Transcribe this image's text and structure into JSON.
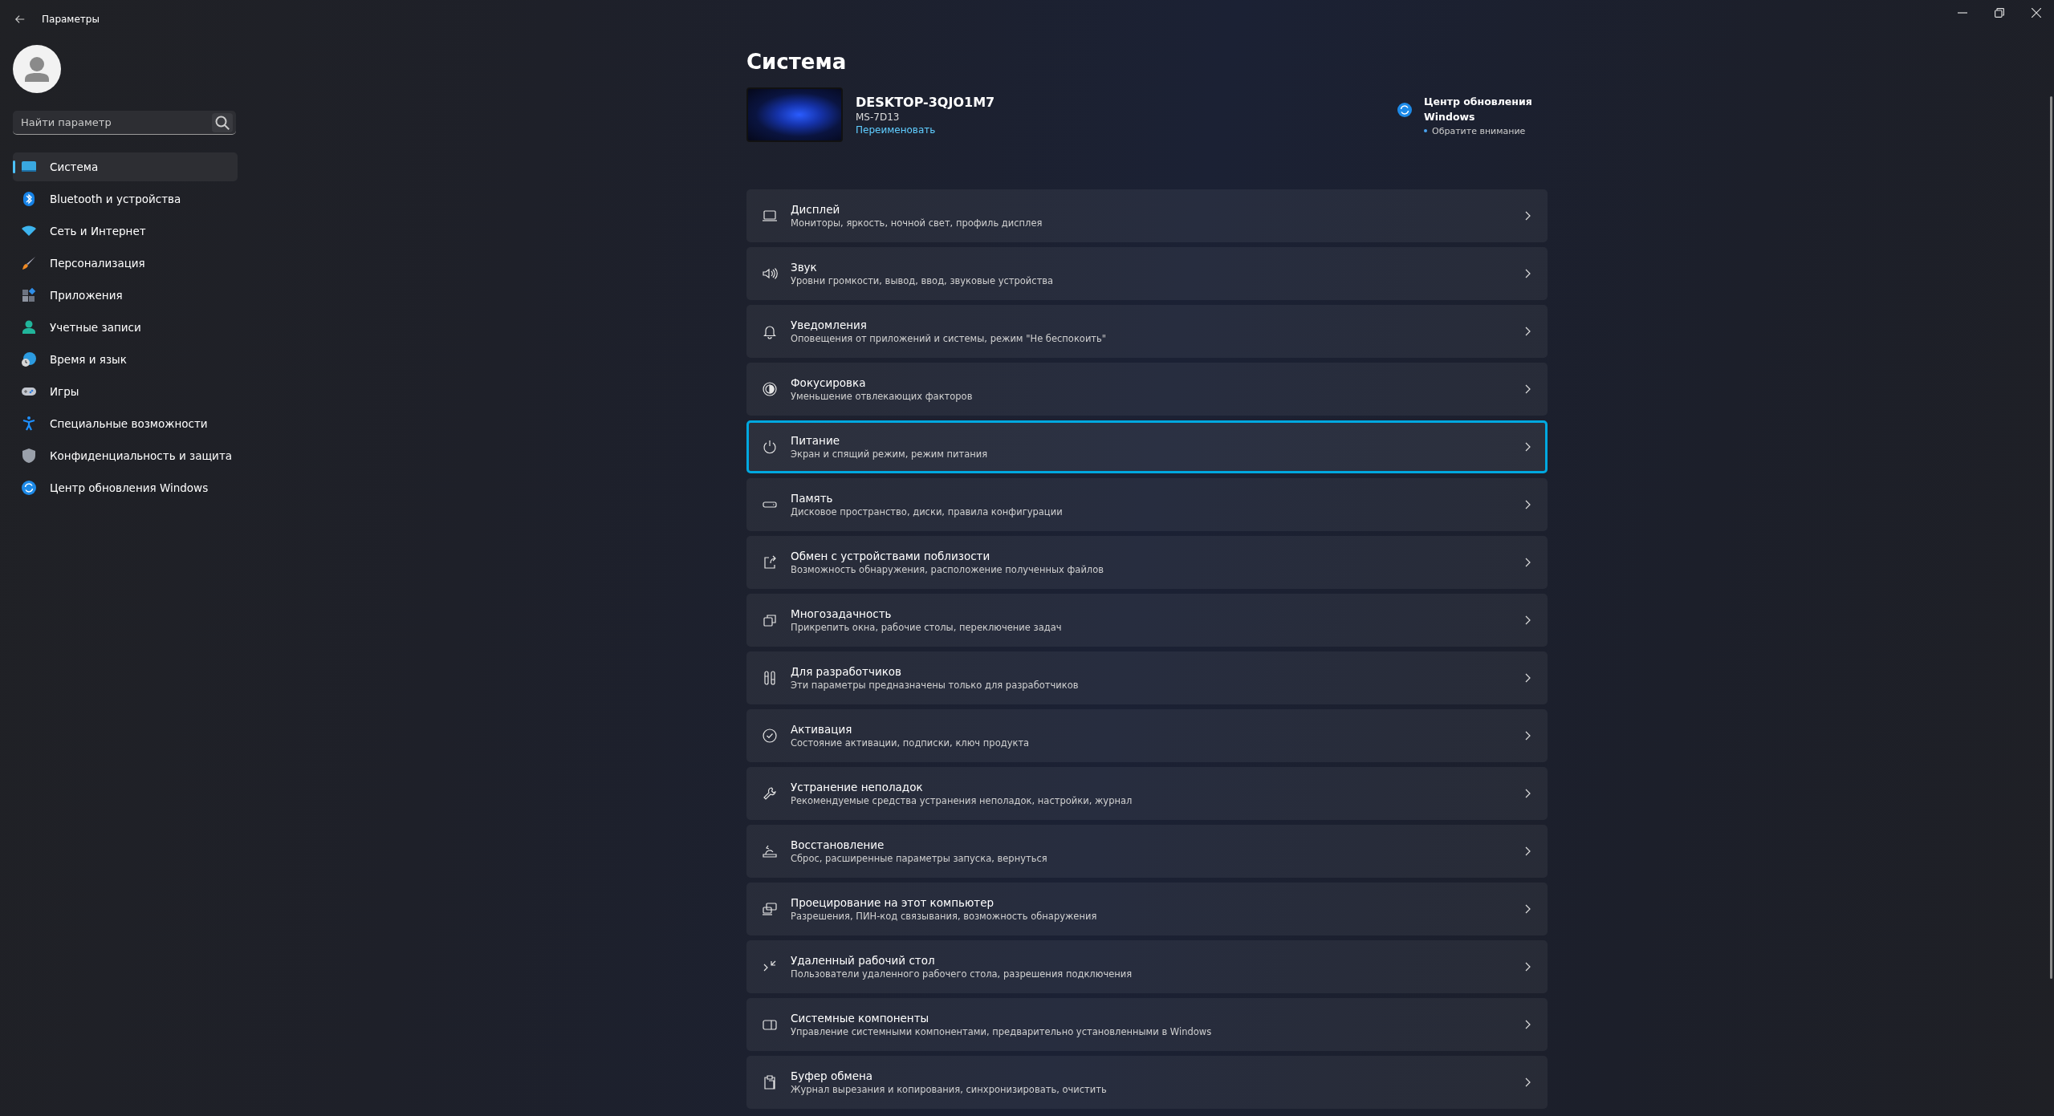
{
  "window": {
    "title": "Параметры"
  },
  "search": {
    "placeholder": "Найти параметр"
  },
  "sidebar": {
    "items": [
      {
        "label": "Система",
        "selected": true
      },
      {
        "label": "Bluetooth и устройства",
        "selected": false
      },
      {
        "label": "Сеть и Интернет",
        "selected": false
      },
      {
        "label": "Персонализация",
        "selected": false
      },
      {
        "label": "Приложения",
        "selected": false
      },
      {
        "label": "Учетные записи",
        "selected": false
      },
      {
        "label": "Время и язык",
        "selected": false
      },
      {
        "label": "Игры",
        "selected": false
      },
      {
        "label": "Специальные возможности",
        "selected": false
      },
      {
        "label": "Конфиденциальность и защита",
        "selected": false
      },
      {
        "label": "Центр обновления Windows",
        "selected": false
      }
    ]
  },
  "page": {
    "title": "Система"
  },
  "device": {
    "name": "DESKTOP-3QJO1M7",
    "model": "MS-7D13",
    "rename_link": "Переименовать"
  },
  "update": {
    "title": "Центр обновления Windows",
    "status": "Обратите внимание"
  },
  "settings": [
    {
      "title": "Дисплей",
      "subtitle": "Мониторы, яркость, ночной свет, профиль дисплея",
      "focused": false
    },
    {
      "title": "Звук",
      "subtitle": "Уровни громкости, вывод, ввод, звуковые устройства",
      "focused": false
    },
    {
      "title": "Уведомления",
      "subtitle": "Оповещения от приложений и системы, режим \"Не беспокоить\"",
      "focused": false
    },
    {
      "title": "Фокусировка",
      "subtitle": "Уменьшение отвлекающих факторов",
      "focused": false
    },
    {
      "title": "Питание",
      "subtitle": "Экран и спящий режим, режим питания",
      "focused": true
    },
    {
      "title": "Память",
      "subtitle": "Дисковое пространство, диски, правила конфигурации",
      "focused": false
    },
    {
      "title": "Обмен с устройствами поблизости",
      "subtitle": "Возможность обнаружения, расположение полученных файлов",
      "focused": false
    },
    {
      "title": "Многозадачность",
      "subtitle": "Прикрепить окна, рабочие столы, переключение задач",
      "focused": false
    },
    {
      "title": "Для разработчиков",
      "subtitle": "Эти параметры предназначены только для разработчиков",
      "focused": false
    },
    {
      "title": "Активация",
      "subtitle": "Состояние активации, подписки, ключ продукта",
      "focused": false
    },
    {
      "title": "Устранение неполадок",
      "subtitle": "Рекомендуемые средства устранения неполадок, настройки, журнал",
      "focused": false
    },
    {
      "title": "Восстановление",
      "subtitle": "Сброс, расширенные параметры запуска, вернуться",
      "focused": false
    },
    {
      "title": "Проецирование на этот компьютер",
      "subtitle": "Разрешения, ПИН-код связывания, возможность обнаружения",
      "focused": false
    },
    {
      "title": "Удаленный рабочий стол",
      "subtitle": "Пользователи удаленного рабочего стола, разрешения подключения",
      "focused": false
    },
    {
      "title": "Системные компоненты",
      "subtitle": "Управление системными компонентами, предварительно установленными в Windows",
      "focused": false
    },
    {
      "title": "Буфер обмена",
      "subtitle": "Журнал вырезания и копирования, синхронизировать, очистить",
      "focused": false
    }
  ]
}
